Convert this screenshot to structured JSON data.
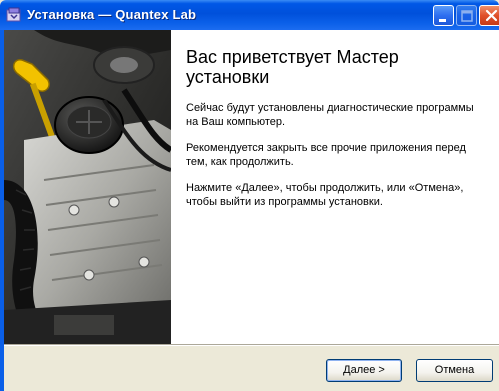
{
  "window": {
    "title": "Установка — Quantex Lab",
    "accent": "#0058e6"
  },
  "icons": {
    "app": "installer-icon",
    "minimize": "minimize-icon",
    "maximize": "maximize-icon",
    "close": "close-icon"
  },
  "wizard": {
    "heading": "Вас приветствует Мастер установки",
    "paragraph1": "Сейчас будут установлены диагностические программы на Ваш компьютер.",
    "paragraph2": "Рекомендуется закрыть все прочие приложения перед тем, как продолжить.",
    "paragraph3": "Нажмите «Далее», чтобы продолжить, или «Отмена», чтобы выйти из программы установки."
  },
  "buttons": {
    "next": "Далее >",
    "cancel": "Отмена"
  }
}
